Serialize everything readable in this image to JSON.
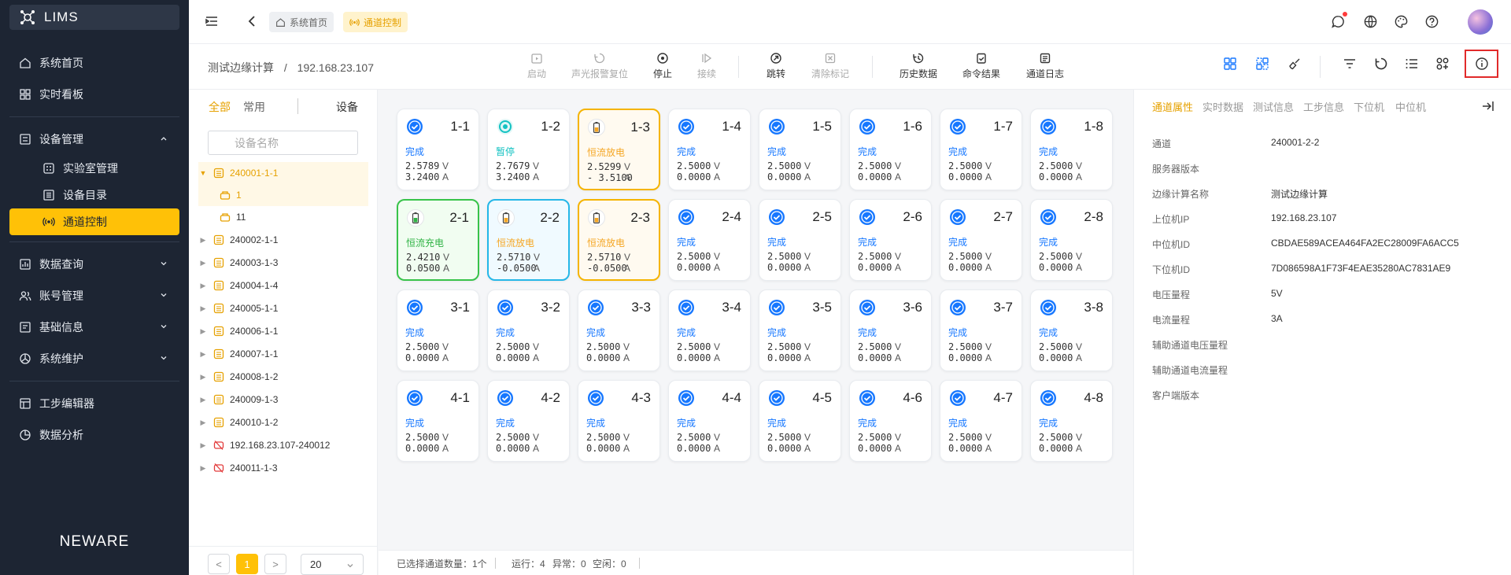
{
  "app": {
    "name": "LIMS",
    "brand": "NEWARE"
  },
  "sidebar": {
    "items": [
      {
        "label": "系统首页",
        "icon": "home-icon"
      },
      {
        "label": "实时看板",
        "icon": "dashboard-icon"
      },
      {
        "label": "设备管理",
        "icon": "device-icon",
        "expanded": true
      },
      {
        "label": "实验室管理",
        "icon": "lab-icon"
      },
      {
        "label": "设备目录",
        "icon": "catalog-icon"
      },
      {
        "label": "通道控制",
        "icon": "channel-icon",
        "active": true
      },
      {
        "label": "数据查询",
        "icon": "chart-icon"
      },
      {
        "label": "账号管理",
        "icon": "users-icon"
      },
      {
        "label": "基础信息",
        "icon": "info-icon"
      },
      {
        "label": "系统维护",
        "icon": "maintenance-icon"
      },
      {
        "label": "工步编辑器",
        "icon": "editor-icon"
      },
      {
        "label": "数据分析",
        "icon": "analysis-icon"
      }
    ]
  },
  "header": {
    "breadcrumbs": [
      {
        "label": "系统首页"
      },
      {
        "label": "通道控制"
      }
    ]
  },
  "toolbar": {
    "path_root": "测试边缘计算",
    "path_sep": "/",
    "path_ip": "192.168.23.107",
    "buttons": [
      {
        "label": "启动",
        "disabled": true
      },
      {
        "label": "声光报警复位",
        "disabled": true
      },
      {
        "label": "停止",
        "disabled": false
      },
      {
        "label": "接续",
        "disabled": true
      },
      {
        "label": "跳转",
        "disabled": false
      },
      {
        "label": "清除标记",
        "disabled": true
      },
      {
        "label": "历史数据",
        "disabled": false
      },
      {
        "label": "命令结果",
        "disabled": false
      },
      {
        "label": "通道日志",
        "disabled": false
      }
    ]
  },
  "tree": {
    "tabs": {
      "all": "全部",
      "common": "常用",
      "device": "设备"
    },
    "search_placeholder": "设备名称",
    "nodes": [
      {
        "label": "240001-1-1",
        "expanded": true
      },
      {
        "label": "1",
        "child": true,
        "selected": true
      },
      {
        "label": "11",
        "child": true
      },
      {
        "label": "240002-1-1"
      },
      {
        "label": "240003-1-3"
      },
      {
        "label": "240004-1-4"
      },
      {
        "label": "240005-1-1"
      },
      {
        "label": "240006-1-1"
      },
      {
        "label": "240007-1-1"
      },
      {
        "label": "240008-1-2"
      },
      {
        "label": "240009-1-3"
      },
      {
        "label": "240010-1-2"
      },
      {
        "label": "192.168.23.107-240012",
        "offline": true
      },
      {
        "label": "240011-1-3",
        "offline": true
      }
    ],
    "pager": {
      "prev": "<",
      "page": "1",
      "next": ">",
      "size": "20"
    }
  },
  "channels": [
    {
      "name": "1-1",
      "status": "完成",
      "v": "2.5789",
      "a": "3.2400",
      "kind": "done"
    },
    {
      "name": "1-2",
      "status": "暂停",
      "v": "2.7679",
      "a": "3.2400",
      "kind": "pause"
    },
    {
      "name": "1-3",
      "status": "恒流放电",
      "v": "2.5299",
      "a": "- 3.5100",
      "kind": "discharge"
    },
    {
      "name": "1-4",
      "status": "完成",
      "v": "2.5000",
      "a": "0.0000",
      "kind": "done"
    },
    {
      "name": "1-5",
      "status": "完成",
      "v": "2.5000",
      "a": "0.0000",
      "kind": "done"
    },
    {
      "name": "1-6",
      "status": "完成",
      "v": "2.5000",
      "a": "0.0000",
      "kind": "done"
    },
    {
      "name": "1-7",
      "status": "完成",
      "v": "2.5000",
      "a": "0.0000",
      "kind": "done"
    },
    {
      "name": "1-8",
      "status": "完成",
      "v": "2.5000",
      "a": "0.0000",
      "kind": "done"
    },
    {
      "name": "2-1",
      "status": "恒流充电",
      "v": "2.4210",
      "a": "0.0500",
      "kind": "charge"
    },
    {
      "name": "2-2",
      "status": "恒流放电",
      "v": "2.5710",
      "a": "-0.0500",
      "kind": "discharge-sel"
    },
    {
      "name": "2-3",
      "status": "恒流放电",
      "v": "2.5710",
      "a": "-0.0500",
      "kind": "discharge"
    },
    {
      "name": "2-4",
      "status": "完成",
      "v": "2.5000",
      "a": "0.0000",
      "kind": "done"
    },
    {
      "name": "2-5",
      "status": "完成",
      "v": "2.5000",
      "a": "0.0000",
      "kind": "done"
    },
    {
      "name": "2-6",
      "status": "完成",
      "v": "2.5000",
      "a": "0.0000",
      "kind": "done"
    },
    {
      "name": "2-7",
      "status": "完成",
      "v": "2.5000",
      "a": "0.0000",
      "kind": "done"
    },
    {
      "name": "2-8",
      "status": "完成",
      "v": "2.5000",
      "a": "0.0000",
      "kind": "done"
    },
    {
      "name": "3-1",
      "status": "完成",
      "v": "2.5000",
      "a": "0.0000",
      "kind": "done"
    },
    {
      "name": "3-2",
      "status": "完成",
      "v": "2.5000",
      "a": "0.0000",
      "kind": "done"
    },
    {
      "name": "3-3",
      "status": "完成",
      "v": "2.5000",
      "a": "0.0000",
      "kind": "done"
    },
    {
      "name": "3-4",
      "status": "完成",
      "v": "2.5000",
      "a": "0.0000",
      "kind": "done"
    },
    {
      "name": "3-5",
      "status": "完成",
      "v": "2.5000",
      "a": "0.0000",
      "kind": "done"
    },
    {
      "name": "3-6",
      "status": "完成",
      "v": "2.5000",
      "a": "0.0000",
      "kind": "done"
    },
    {
      "name": "3-7",
      "status": "完成",
      "v": "2.5000",
      "a": "0.0000",
      "kind": "done"
    },
    {
      "name": "3-8",
      "status": "完成",
      "v": "2.5000",
      "a": "0.0000",
      "kind": "done"
    },
    {
      "name": "4-1",
      "status": "完成",
      "v": "2.5000",
      "a": "0.0000",
      "kind": "done"
    },
    {
      "name": "4-2",
      "status": "完成",
      "v": "2.5000",
      "a": "0.0000",
      "kind": "done"
    },
    {
      "name": "4-3",
      "status": "完成",
      "v": "2.5000",
      "a": "0.0000",
      "kind": "done"
    },
    {
      "name": "4-4",
      "status": "完成",
      "v": "2.5000",
      "a": "0.0000",
      "kind": "done"
    },
    {
      "name": "4-5",
      "status": "完成",
      "v": "2.5000",
      "a": "0.0000",
      "kind": "done"
    },
    {
      "name": "4-6",
      "status": "完成",
      "v": "2.5000",
      "a": "0.0000",
      "kind": "done"
    },
    {
      "name": "4-7",
      "status": "完成",
      "v": "2.5000",
      "a": "0.0000",
      "kind": "done"
    },
    {
      "name": "4-8",
      "status": "完成",
      "v": "2.5000",
      "a": "0.0000",
      "kind": "done"
    }
  ],
  "units": {
    "v": "V",
    "a": "A"
  },
  "statusbar": {
    "selected": "已选择通道数量：1个",
    "running": "运行：4",
    "abnormal": "异常：0",
    "idle": "空闲：0"
  },
  "detail": {
    "tabs": [
      "通道属性",
      "实时数据",
      "测试信息",
      "工步信息",
      "下位机",
      "中位机"
    ],
    "rows": [
      {
        "label": "通道",
        "value": "240001-2-2"
      },
      {
        "label": "服务器版本",
        "value": ""
      },
      {
        "label": "边缘计算名称",
        "value": "测试边缘计算"
      },
      {
        "label": "上位机IP",
        "value": "192.168.23.107"
      },
      {
        "label": "中位机ID",
        "value": "CBDAE589ACEA464FA2EC28009FA6ACC5"
      },
      {
        "label": "下位机ID",
        "value": "7D086598A1F73F4EAE35280AC7831AE9"
      },
      {
        "label": "电压量程",
        "value": "5V"
      },
      {
        "label": "电流量程",
        "value": "3A"
      },
      {
        "label": "辅助通道电压量程",
        "value": ""
      },
      {
        "label": "辅助通道电流量程",
        "value": ""
      },
      {
        "label": "客户端版本",
        "value": ""
      }
    ]
  },
  "colors": {
    "accent": "#ffc107",
    "sidebar_bg": "#1d2533",
    "done_blue": "#1677ff",
    "pause_cyan": "#13c2c2",
    "discharge_orange": "#f5a623",
    "charge_green": "#2fb344"
  }
}
